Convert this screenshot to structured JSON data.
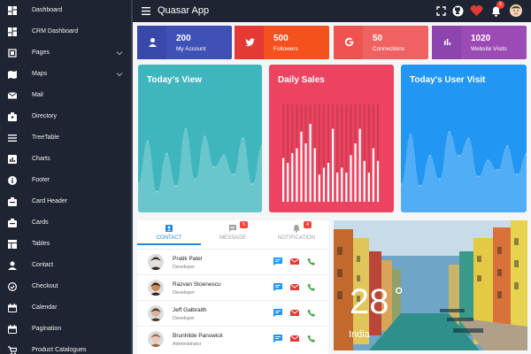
{
  "sidebar": {
    "items": [
      {
        "label": "Dashboard",
        "icon": "dashboard-icon"
      },
      {
        "label": "CRM Dashboard",
        "icon": "dashboard-icon"
      },
      {
        "label": "Pages",
        "icon": "pages-icon",
        "expandable": true
      },
      {
        "label": "Maps",
        "icon": "map-icon",
        "expandable": true
      },
      {
        "label": "Mail",
        "icon": "mail-icon"
      },
      {
        "label": "Directory",
        "icon": "directory-icon"
      },
      {
        "label": "TreeTable",
        "icon": "list-icon"
      },
      {
        "label": "Charts",
        "icon": "chart-icon"
      },
      {
        "label": "Footer",
        "icon": "info-icon"
      },
      {
        "label": "Card Header",
        "icon": "card-icon"
      },
      {
        "label": "Cards",
        "icon": "card-icon"
      },
      {
        "label": "Tables",
        "icon": "table-icon"
      },
      {
        "label": "Contact",
        "icon": "person-icon"
      },
      {
        "label": "Checkout",
        "icon": "check-circle-icon"
      },
      {
        "label": "Calendar",
        "icon": "calendar-icon"
      },
      {
        "label": "Pagination",
        "icon": "calendar-icon"
      },
      {
        "label": "Product Catalogues",
        "icon": "cart-icon"
      }
    ]
  },
  "header": {
    "title": "Quasar App",
    "notification_count": "5"
  },
  "stats": [
    {
      "value": "200",
      "label": "My Account",
      "color": "#3f51b5",
      "iconColor": "#3949ab",
      "icon": "person-icon"
    },
    {
      "value": "500",
      "label": "Followers",
      "color": "#f4511e",
      "iconColor": "#e53935",
      "icon": "twitter-icon"
    },
    {
      "value": "50",
      "label": "Connections",
      "color": "#f06262",
      "iconColor": "#ef5350",
      "icon": "google-icon"
    },
    {
      "value": "1020",
      "label": "Website Visits",
      "color": "#9c4bb5",
      "iconColor": "#8e44ad",
      "icon": "bar-chart-icon"
    }
  ],
  "cards": {
    "today_view": {
      "title": "Today's View",
      "color": "#3fb6be",
      "values": [
        30,
        75,
        22,
        62,
        28,
        88,
        35,
        80,
        48,
        60,
        40,
        78,
        30,
        70
      ]
    },
    "daily_sales": {
      "title": "Daily Sales",
      "color": "#ec4460",
      "values": [
        45,
        40,
        50,
        55,
        72,
        60,
        80,
        55,
        28,
        35,
        40,
        75,
        30,
        35,
        30,
        48,
        60,
        75,
        42,
        30,
        55,
        42
      ]
    },
    "user_visit": {
      "title": "Today's User Visit",
      "color": "#2196f3",
      "values": [
        30,
        82,
        28,
        60,
        35,
        85,
        60,
        78,
        38,
        55,
        45,
        70,
        40,
        62
      ]
    }
  },
  "contacts": {
    "tabs": [
      {
        "label": "CONTACT",
        "icon": "contact-card-icon",
        "badge": ""
      },
      {
        "label": "MESSAGE",
        "icon": "message-icon",
        "badge": "5"
      },
      {
        "label": "NOTIFICATION",
        "icon": "bell-icon",
        "badge": "4"
      }
    ],
    "rows": [
      {
        "name": "Pratik Patel",
        "role": "Developer"
      },
      {
        "name": "Razvan Stoenescu",
        "role": "Developer"
      },
      {
        "name": "Jeff Galbraith",
        "role": "Developer"
      },
      {
        "name": "Brunhilde Panswick",
        "role": "Administrator"
      }
    ]
  },
  "weather": {
    "temperature": "28",
    "degree": "°",
    "location": "India"
  }
}
